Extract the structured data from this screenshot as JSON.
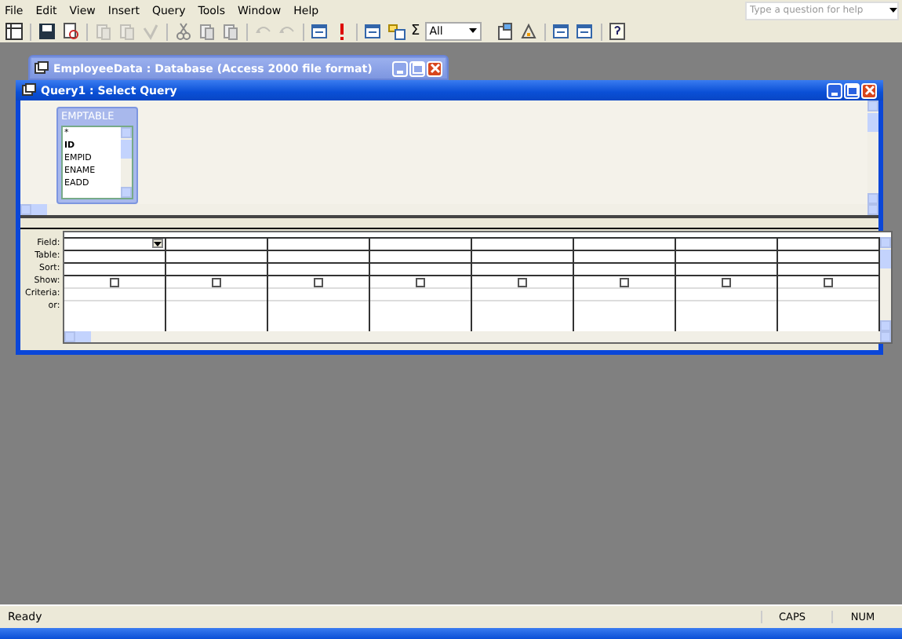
{
  "menu": [
    "File",
    "Edit",
    "View",
    "Insert",
    "Query",
    "Tools",
    "Window",
    "Help"
  ],
  "help_box": {
    "placeholder": "Type a question for help"
  },
  "toolbar": {
    "totals_glyph": "Σ",
    "top_values": "All"
  },
  "background_window": {
    "title": "EmployeeData : Database (Access 2000 file format)"
  },
  "query_window": {
    "title": "Query1 : Select Query",
    "table": {
      "title": "EMPTABLE",
      "fields": [
        "*",
        "ID",
        "EMPID",
        "ENAME",
        "EADD"
      ]
    },
    "grid": {
      "row_labels": [
        "Field:",
        "Table:",
        "Sort:",
        "Show:",
        "Criteria:",
        "or:"
      ],
      "columns": [
        {
          "dropdown": true,
          "show": false
        },
        {
          "dropdown": false,
          "show": false
        },
        {
          "dropdown": false,
          "show": false
        },
        {
          "dropdown": false,
          "show": false
        },
        {
          "dropdown": false,
          "show": false
        },
        {
          "dropdown": false,
          "show": false
        },
        {
          "dropdown": false,
          "show": false
        },
        {
          "dropdown": false,
          "show": false
        }
      ]
    }
  },
  "status_bar": {
    "message": "Ready",
    "indicators": [
      "CAPS",
      "NUM"
    ]
  }
}
